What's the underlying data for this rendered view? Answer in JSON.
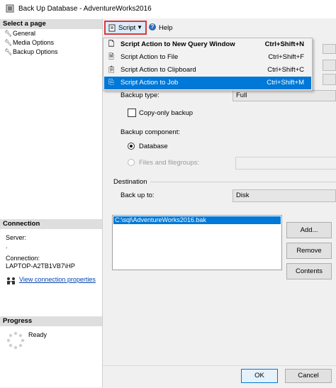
{
  "window": {
    "title": "Back Up Database - AdventureWorks2016"
  },
  "left_pane": {
    "select_page_header": "Select a page",
    "pages": [
      {
        "label": "General",
        "icon": "wrench-icon"
      },
      {
        "label": "Media Options",
        "icon": "wrench-icon"
      },
      {
        "label": "Backup Options",
        "icon": "wrench-icon"
      }
    ],
    "connection_header": "Connection",
    "server_label": "Server:",
    "server_value": ".",
    "connection_label": "Connection:",
    "connection_value": "LAPTOP-A2TB1VB7\\HP",
    "view_connection_link": "View connection properties",
    "progress_header": "Progress",
    "progress_status": "Ready"
  },
  "toolbar": {
    "script_label": "Script",
    "help_label": "Help"
  },
  "script_menu": {
    "items": [
      {
        "label": "Script Action to New Query Window",
        "shortcut": "Ctrl+Shift+N",
        "icon": "new-query-icon",
        "bold": true,
        "selected": false
      },
      {
        "label": "Script Action to File",
        "shortcut": "Ctrl+Shift+F",
        "icon": "file-icon",
        "bold": false,
        "selected": false
      },
      {
        "label": "Script Action to Clipboard",
        "shortcut": "Ctrl+Shift+C",
        "icon": "clipboard-icon",
        "bold": false,
        "selected": false
      },
      {
        "label": "Script Action to Job",
        "shortcut": "Ctrl+Shift+M",
        "icon": "job-icon",
        "bold": false,
        "selected": true
      }
    ]
  },
  "form": {
    "backup_type_label": "Backup type:",
    "backup_type_value": "Full",
    "copy_only_label": "Copy-only backup",
    "backup_component_label": "Backup component:",
    "database_option": "Database",
    "files_option": "Files and filegroups:",
    "destination_label": "Destination",
    "back_up_to_label": "Back up to:",
    "back_up_to_value": "Disk",
    "destination_items": [
      "C:\\sql\\AdventureWorks2016.bak"
    ]
  },
  "buttons": {
    "add": "Add...",
    "remove": "Remove",
    "contents": "Contents",
    "ok": "OK",
    "cancel": "Cancel"
  },
  "colors": {
    "selection": "#0078d7",
    "highlight_border": "#d9393e",
    "link": "#0645ad"
  }
}
